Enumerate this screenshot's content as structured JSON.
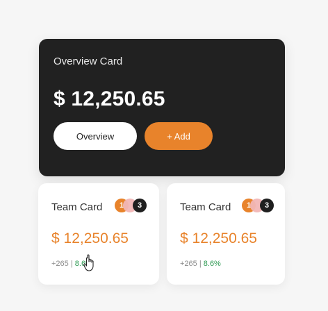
{
  "overview_card": {
    "title": "Overview Card",
    "amount": "$ 12,250.65",
    "overview_button_label": "Overview",
    "add_button_label": "+ Add",
    "background_color": "#212121",
    "accent_color": "#e8832b"
  },
  "team_cards": [
    {
      "title": "Team Card",
      "badges": [
        "1",
        "",
        "3"
      ],
      "amount": "$ 12,250.65",
      "stat_count": "+265",
      "separator": "|",
      "stat_percent": "8.6%"
    },
    {
      "title": "Team Card",
      "badges": [
        "1",
        "",
        "3"
      ],
      "amount": "$ 12,250.65",
      "stat_count": "+265",
      "separator": "|",
      "stat_percent": "8.6%"
    }
  ],
  "cursor": {
    "icon": "hand-pointer-icon"
  }
}
